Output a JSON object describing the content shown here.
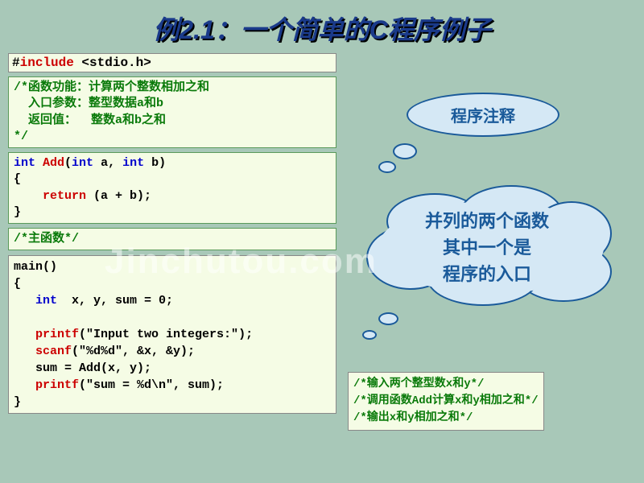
{
  "title": "例2.1：一个简单的C程序例子",
  "include": {
    "hash": "#",
    "inc": "include",
    "rest": " <stdio.h>"
  },
  "comment_block": "/*函数功能：计算两个整数相加之和\n  入口参数：整型数据a和b\n  返回值：  整数a和b之和\n*/",
  "add_fn": {
    "l1a": "int ",
    "l1b": "Add",
    "l1c": "(",
    "l1d": "int",
    "l1e": " a, ",
    "l1f": "int",
    "l1g": " b)",
    "l2": "{",
    "l3a": "    ",
    "l3b": "return",
    "l3c": " (a + b);",
    "l4": "}"
  },
  "main_comment": "/*主函数*/",
  "main_fn": {
    "l1": "main()",
    "l2": "{",
    "l3a": "   ",
    "l3b": "int",
    "l3c": "  x, y, sum = 0;",
    "blank": " ",
    "l4a": "   ",
    "l4b": "printf",
    "l4c": "(\"Input two integers:\");",
    "l5a": "   ",
    "l5b": "scanf",
    "l5c": "(\"%d%d\", &x, &y);",
    "l6": "   sum = Add(x, y);",
    "l7a": "   ",
    "l7b": "printf",
    "l7c": "(\"sum = %d\\n\", sum);",
    "l8": "}"
  },
  "side_comments": "/*输入两个整型数x和y*/\n/*调用函数Add计算x和y相加之和*/\n/*输出x和y相加之和*/",
  "bubble1": "程序注释",
  "cloud": {
    "line1": "并列的两个函数",
    "line2": "其中一个是",
    "line3": "程序的入口"
  },
  "watermark": "Jinchutou.com"
}
